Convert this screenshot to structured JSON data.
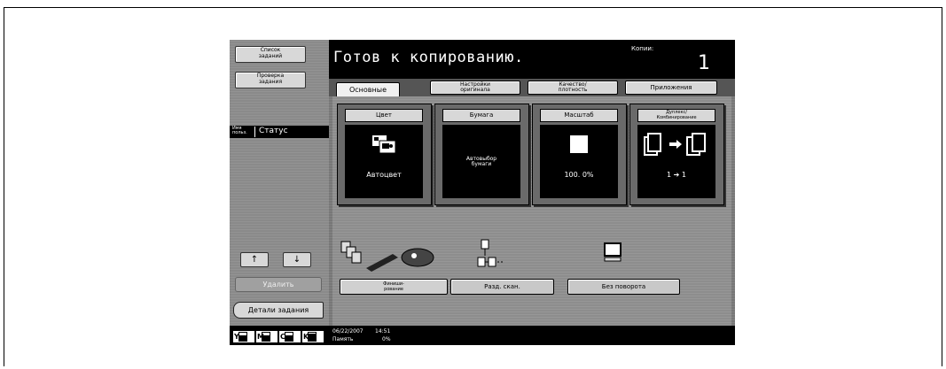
{
  "left_panel": {
    "job_list_button": [
      "Список",
      "заданий"
    ],
    "job_check_button": [
      "Проверка",
      "задания"
    ],
    "user_header_user": [
      "Имя",
      "польз."
    ],
    "user_header_status": "Статус",
    "up_arrow": "↑",
    "down_arrow": "↓",
    "delete_button": "Удалить",
    "job_details_button": "Детали задания",
    "toners": [
      {
        "label": "Y",
        "level": 0.7
      },
      {
        "label": "M",
        "level": 0.7
      },
      {
        "label": "C",
        "level": 0.7
      },
      {
        "label": "K",
        "level": 0.9
      }
    ]
  },
  "header": {
    "title": "Готов к копированию.",
    "copies_label": "Копии:",
    "copies_value": "1"
  },
  "tabs": [
    {
      "label": "Основные"
    },
    {
      "label": [
        "Настройки",
        "оригинала"
      ]
    },
    {
      "label": [
        "Качество/",
        "плотность"
      ]
    },
    {
      "label": "Приложения"
    }
  ],
  "cards": {
    "color": {
      "header": "Цвет",
      "value": "Автоцвет"
    },
    "paper": {
      "header": "Бумага",
      "value": [
        "Автовыбор",
        "бумаги"
      ]
    },
    "zoom": {
      "header": "Масштаб",
      "value": "100. 0%"
    },
    "duplex": {
      "header": [
        "Дуплекс/",
        "Комбинирование"
      ],
      "value": "1 ➔ 1"
    }
  },
  "bottom_buttons": {
    "finishing": [
      "Финиши-",
      "рование"
    ],
    "separate_scan": "Разд. скан.",
    "no_rotation": "Без поворота"
  },
  "status": {
    "date": "06/22/2007",
    "time": "14:51",
    "memory_label": "Память",
    "memory_value": "0%"
  }
}
